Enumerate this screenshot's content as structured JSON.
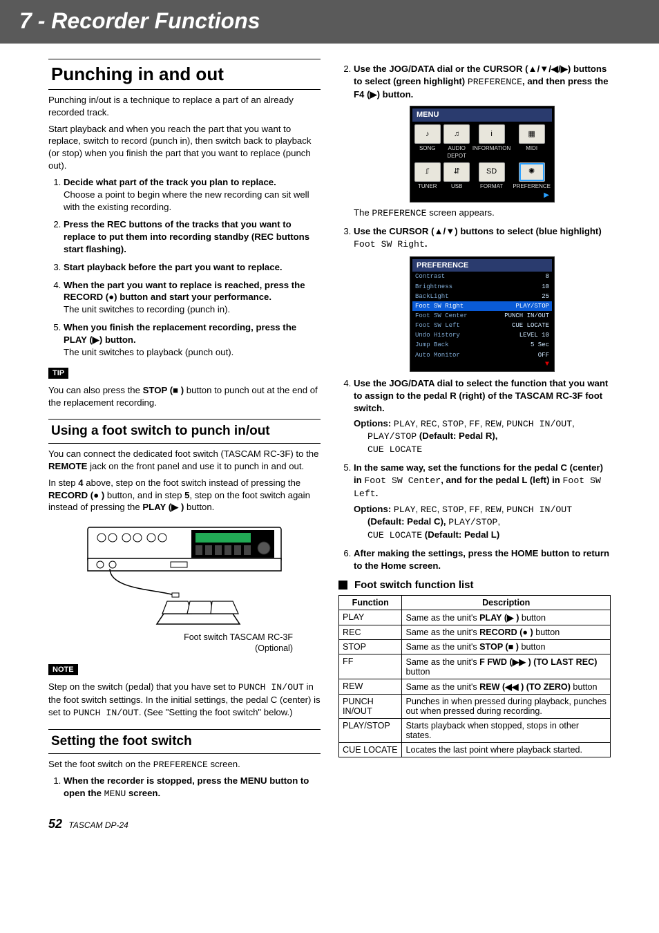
{
  "chapter": "7 - Recorder Functions",
  "left": {
    "h1": "Punching in and out",
    "p1": "Punching in/out is a technique to replace a part of an already recorded track.",
    "p2": "Start playback and when you reach the part that you want to replace, switch to record (punch in), then switch back to playback (or stop) when you finish the part that you want to replace (punch out).",
    "s1_head": "Decide what part of the track you plan to replace.",
    "s1_body": "Choose a point to begin where the new recording can sit well with the existing recording.",
    "s2_head": "Press the REC buttons of the tracks that you want to replace to put them into recording standby (REC buttons start flashing).",
    "s3_head": "Start playback before the part you want to replace.",
    "s4_head": "When the part you want to replace is reached, press the RECORD (●) button and start your performance.",
    "s4_body": "The unit switches to recording (punch in).",
    "s5_head": "When you finish the replacement recording, press the PLAY (▶) button.",
    "s5_body": "The unit switches to playback (punch out).",
    "tip_label": "TIP",
    "tip_a": "You can also press the ",
    "tip_b": "STOP (■ )",
    "tip_c": " button to punch out at the end of the replacement recording.",
    "h2a": "Using a foot switch to punch in/out",
    "fs_p1": "You can connect the dedicated foot switch (TASCAM RC-3F) to the ",
    "fs_remote": "REMOTE",
    "fs_p1b": " jack on the front panel and use it to punch in and out.",
    "fs_p2a": "In step ",
    "fs_p2b": "4",
    "fs_p2c": " above, step on the foot switch instead of pressing the ",
    "fs_rec": "RECORD (● )",
    "fs_p2d": " button, and in step ",
    "fs_p2e": "5",
    "fs_p2f": ", step on the foot switch again instead of pressing the ",
    "fs_play": "PLAY (▶ )",
    "fs_p2g": " button.",
    "caption1": "Foot switch TASCAM RC-3F",
    "caption2": "(Optional)",
    "note_label": "NOTE",
    "note_a": "Step on the switch (pedal) that you have set to ",
    "note_lcd1": "PUNCH IN/OUT",
    "note_b": " in the foot switch settings. In the initial settings, the pedal C (center) is set to ",
    "note_lcd2": "PUNCH IN/OUT",
    "note_c": ". (See \"Setting the foot switch\" below.)",
    "h2b": "Setting the foot switch",
    "set_p1a": "Set the foot switch on the ",
    "set_lcd": "PREFERENCE",
    "set_p1b": " screen.",
    "set_s1a": "When the recorder is stopped, press the MENU button to open the ",
    "set_s1_lcd": "MENU",
    "set_s1b": " screen."
  },
  "right": {
    "s2_a": "Use the JOG/DATA dial or the CURSOR (▲/▼/◀/▶) buttons to select (green highlight) ",
    "s2_lcd": "PREFERENCE",
    "s2_b": ", and then press the F4 (▶) button.",
    "menu": {
      "title": "MENU",
      "items": [
        "SONG",
        "AUDIO DEPOT",
        "INFORMATION",
        "MIDI",
        "TUNER",
        "USB",
        "FORMAT",
        "PREFERENCE"
      ],
      "selected": 7,
      "arrow": "▶"
    },
    "s2_after_a": "The ",
    "s2_after_lcd": "PREFERENCE",
    "s2_after_b": " screen appears.",
    "s3_a": "Use the CURSOR (▲/▼) buttons to select (blue highlight) ",
    "s3_lcd": "Foot SW Right",
    "s3_b": ".",
    "pref": {
      "title": "PREFERENCE",
      "rows": [
        {
          "lbl": "Contrast",
          "val": "8"
        },
        {
          "lbl": "Brightness",
          "val": "10"
        },
        {
          "lbl": "BackLight",
          "val": "25"
        },
        {
          "lbl": "Foot SW Right",
          "val": "PLAY/STOP",
          "hl": true
        },
        {
          "lbl": "Foot SW Center",
          "val": "PUNCH IN/OUT"
        },
        {
          "lbl": "Foot SW Left",
          "val": "CUE LOCATE"
        },
        {
          "lbl": "Undo History",
          "val": "LEVEL 10"
        },
        {
          "lbl": "Jump Back",
          "val": "5 Sec"
        },
        {
          "lbl": "Auto Monitor",
          "val": "OFF"
        }
      ],
      "arrow": "▼"
    },
    "s4_head": "Use the JOG/DATA dial to select the function that you want to assign to the pedal R (right) of the TASCAM RC-3F foot switch.",
    "s4_opts_label": "Options: ",
    "s4_opts_lcd1": "PLAY",
    "s4_opts_c1": ", ",
    "s4_opts_lcd2": "REC",
    "s4_opts_c2": ", ",
    "s4_opts_lcd3": "STOP",
    "s4_opts_c3": ", ",
    "s4_opts_lcd4": "FF",
    "s4_opts_c4": ", ",
    "s4_opts_lcd5": "REW",
    "s4_opts_c5": ", ",
    "s4_opts_lcd6": "PUNCH IN/OUT",
    "s4_opts_c6": ", ",
    "s4_opts_lcd7": "PLAY/STOP",
    "s4_opts_def": " (Default: Pedal R),",
    "s4_opts_lcd8": "CUE LOCATE",
    "s5_a": "In the same way, set the functions for the pedal C (center) in ",
    "s5_lcd1": "Foot SW Center",
    "s5_b": ", and for the pedal L (left) in ",
    "s5_lcd2": "Foot SW Left",
    "s5_c": ".",
    "s5_opts_label": "Options: ",
    "s5_o1": "PLAY",
    "s5_c1": ", ",
    "s5_o2": "REC",
    "s5_c2": ", ",
    "s5_o3": "STOP",
    "s5_c3": ", ",
    "s5_o4": "FF",
    "s5_c4": ", ",
    "s5_o5": "REW",
    "s5_c5": ", ",
    "s5_o6": "PUNCH IN/OUT",
    "s5_defc": " (Default: Pedal C), ",
    "s5_o7": "PLAY/STOP",
    "s5_c7": ", ",
    "s5_o8": "CUE LOCATE",
    "s5_defl": " (Default: Pedal L)",
    "s6_head": "After making the settings, press the HOME button to return to the Home screen.",
    "sub_head": "Foot switch function list",
    "th1": "Function",
    "th2": "Description",
    "rows": [
      {
        "f": "PLAY",
        "d_a": "Same as the unit's ",
        "d_b": "PLAY (▶ )",
        "d_c": " button"
      },
      {
        "f": "REC",
        "d_a": "Same as the unit's ",
        "d_b": "RECORD (● )",
        "d_c": " button"
      },
      {
        "f": "STOP",
        "d_a": "Same as the unit's ",
        "d_b": "STOP (■ )",
        "d_c": " button"
      },
      {
        "f": "FF",
        "d_a": "Same as the unit's ",
        "d_b": "F FWD (▶▶ ) (TO LAST REC)",
        "d_c": " button"
      },
      {
        "f": "REW",
        "d_a": "Same as the unit's ",
        "d_b": "REW (◀◀ ) (TO ZERO)",
        "d_c": " button"
      },
      {
        "f": "PUNCH IN/OUT",
        "d_plain": "Punches in when pressed during playback, punches out when pressed during recording."
      },
      {
        "f": "PLAY/STOP",
        "d_plain": "Starts playback when stopped, stops in other states."
      },
      {
        "f": "CUE LOCATE",
        "d_plain": "Locates the last point where playback started."
      }
    ]
  },
  "footer": {
    "page": "52",
    "model": "TASCAM DP-24"
  }
}
